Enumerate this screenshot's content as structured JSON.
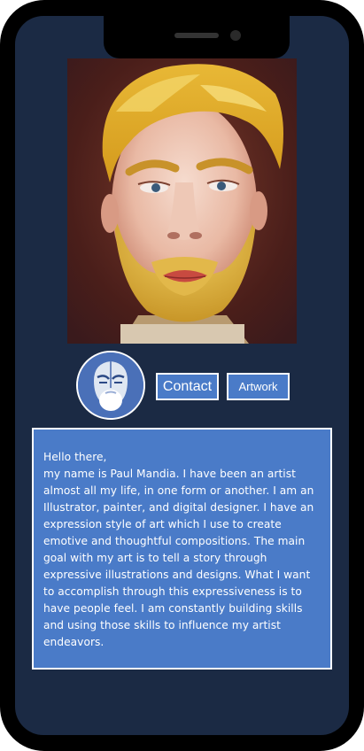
{
  "profile": {
    "portrait_alt": "Painted self-portrait",
    "logo_alt": "Artist logo"
  },
  "nav": {
    "contact_label": "Contact",
    "artwork_label": "Artwork"
  },
  "bio": {
    "greeting": "Hello there,",
    "body": "my name is Paul Mandia. I have been an artist almost all my life, in one form or another. I am an Illustrator, painter, and digital designer. I have an expression style of art which I use to create emotive and thoughtful compositions. The main goal with my art is to tell a story through expressive illustrations and designs. What I want to accomplish through this expressiveness is to have people feel. I am constantly building skills and using those skills to influence my artist endeavors."
  },
  "colors": {
    "background": "#1b2a44",
    "panel": "#4a7bc8",
    "border": "#ffffff",
    "text": "#ffffff"
  }
}
